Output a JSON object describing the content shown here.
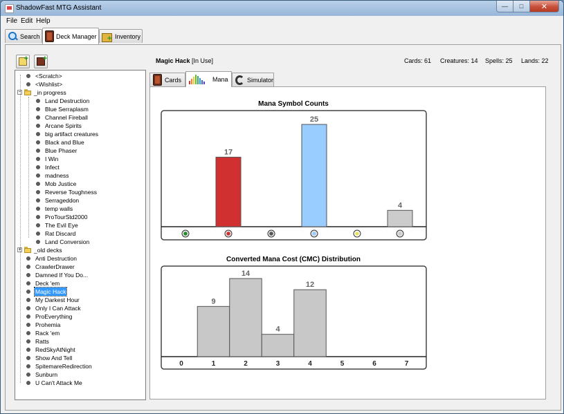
{
  "window": {
    "title": "ShadowFast MTG Assistant",
    "controls": {
      "minimize": "—",
      "maximize": "□",
      "close": "✕"
    }
  },
  "menu": {
    "file": "File",
    "edit": "Edit",
    "help": "Help"
  },
  "main_tabs": [
    {
      "label": "Search",
      "icon": "search-icon"
    },
    {
      "label": "Deck Manager",
      "icon": "deck-icon",
      "active": true
    },
    {
      "label": "Inventory",
      "icon": "inventory-box-icon"
    }
  ],
  "toolbar": {
    "new_deck_icon": "new-deck-icon",
    "import_deck_icon": "import-deck-icon"
  },
  "tree": {
    "items": [
      {
        "label": "<Scratch>",
        "level": 1,
        "type": "deck"
      },
      {
        "label": "<Wishlist>",
        "level": 1,
        "type": "deck"
      },
      {
        "label": "_in progress",
        "level": 0,
        "type": "folder",
        "expanded": true
      },
      {
        "label": "Land Destruction",
        "level": 2,
        "type": "deck"
      },
      {
        "label": "Blue Serraplasm",
        "level": 2,
        "type": "deck"
      },
      {
        "label": "Channel Fireball",
        "level": 2,
        "type": "deck"
      },
      {
        "label": "Arcane Spirits",
        "level": 2,
        "type": "deck"
      },
      {
        "label": "big artifact creatures",
        "level": 2,
        "type": "deck"
      },
      {
        "label": "Black and Blue",
        "level": 2,
        "type": "deck"
      },
      {
        "label": "Blue Phaser",
        "level": 2,
        "type": "deck"
      },
      {
        "label": "I Win",
        "level": 2,
        "type": "deck"
      },
      {
        "label": "Infect",
        "level": 2,
        "type": "deck"
      },
      {
        "label": "madness",
        "level": 2,
        "type": "deck"
      },
      {
        "label": "Mob Justice",
        "level": 2,
        "type": "deck"
      },
      {
        "label": "Reverse Toughness",
        "level": 2,
        "type": "deck"
      },
      {
        "label": "Serrageddon",
        "level": 2,
        "type": "deck"
      },
      {
        "label": "temp walls",
        "level": 2,
        "type": "deck"
      },
      {
        "label": "ProTourStd2000",
        "level": 2,
        "type": "deck"
      },
      {
        "label": "The Evil Eye",
        "level": 2,
        "type": "deck"
      },
      {
        "label": "Rat Discard",
        "level": 2,
        "type": "deck"
      },
      {
        "label": "Land Conversion",
        "level": 2,
        "type": "deck"
      },
      {
        "label": "_old decks",
        "level": 0,
        "type": "folder",
        "expanded": false
      },
      {
        "label": "Anti Destruction",
        "level": 1,
        "type": "deck"
      },
      {
        "label": "CrawlerDrawer",
        "level": 1,
        "type": "deck"
      },
      {
        "label": "Damned If You Do...",
        "level": 1,
        "type": "deck"
      },
      {
        "label": "Deck 'em",
        "level": 1,
        "type": "deck"
      },
      {
        "label": "Magic Hack",
        "level": 1,
        "type": "deck",
        "selected": true
      },
      {
        "label": "My Darkest Hour",
        "level": 1,
        "type": "deck"
      },
      {
        "label": "Only I Can Attack",
        "level": 1,
        "type": "deck"
      },
      {
        "label": "ProEverything",
        "level": 1,
        "type": "deck"
      },
      {
        "label": "Prohemia",
        "level": 1,
        "type": "deck"
      },
      {
        "label": "Rack 'em",
        "level": 1,
        "type": "deck"
      },
      {
        "label": "Ratts",
        "level": 1,
        "type": "deck"
      },
      {
        "label": "RedSkyAtNight",
        "level": 1,
        "type": "deck"
      },
      {
        "label": "Show And Tell",
        "level": 1,
        "type": "deck"
      },
      {
        "label": "SpitemareRedirection",
        "level": 1,
        "type": "deck"
      },
      {
        "label": "Sunburn",
        "level": 1,
        "type": "deck"
      },
      {
        "label": "U Can't Attack Me",
        "level": 1,
        "type": "deck"
      }
    ],
    "expander_collapse": "−",
    "expander_expand": "+"
  },
  "deck": {
    "name": "Magic Hack",
    "status": "[In Use]",
    "cards": "Cards: 61",
    "creatures": "Creatures: 14",
    "spells": "Spells: 25",
    "lands": "Lands: 22"
  },
  "sub_tabs": [
    {
      "label": "Cards",
      "icon": "cards-icon"
    },
    {
      "label": "Mana",
      "icon": "mana-chart-icon",
      "active": true
    },
    {
      "label": "Simulator",
      "icon": "simulator-icon"
    }
  ],
  "chart_data": [
    {
      "type": "bar",
      "title": "Mana Symbol Counts",
      "categories": [
        "green",
        "red",
        "black",
        "blue",
        "white",
        "colorless"
      ],
      "category_icons": [
        "green-mana-icon",
        "red-mana-icon",
        "black-mana-icon",
        "blue-mana-icon",
        "white-mana-icon",
        "colorless-mana-icon"
      ],
      "values": [
        0,
        17,
        0,
        25,
        0,
        4
      ],
      "bar_colors": [
        "#2a8a2a",
        "#d03030",
        "#555555",
        "#99ccff",
        "#e8e060",
        "#cccccc"
      ],
      "ylim": [
        0,
        25
      ]
    },
    {
      "type": "bar",
      "title": "Converted Mana Cost (CMC) Distribution",
      "categories": [
        "0",
        "1",
        "2",
        "3",
        "4",
        "5",
        "6",
        "7"
      ],
      "values": [
        0,
        9,
        14,
        4,
        12,
        0,
        0,
        0
      ],
      "bar_color": "#c8c8c8",
      "ylim": [
        0,
        14
      ]
    }
  ]
}
